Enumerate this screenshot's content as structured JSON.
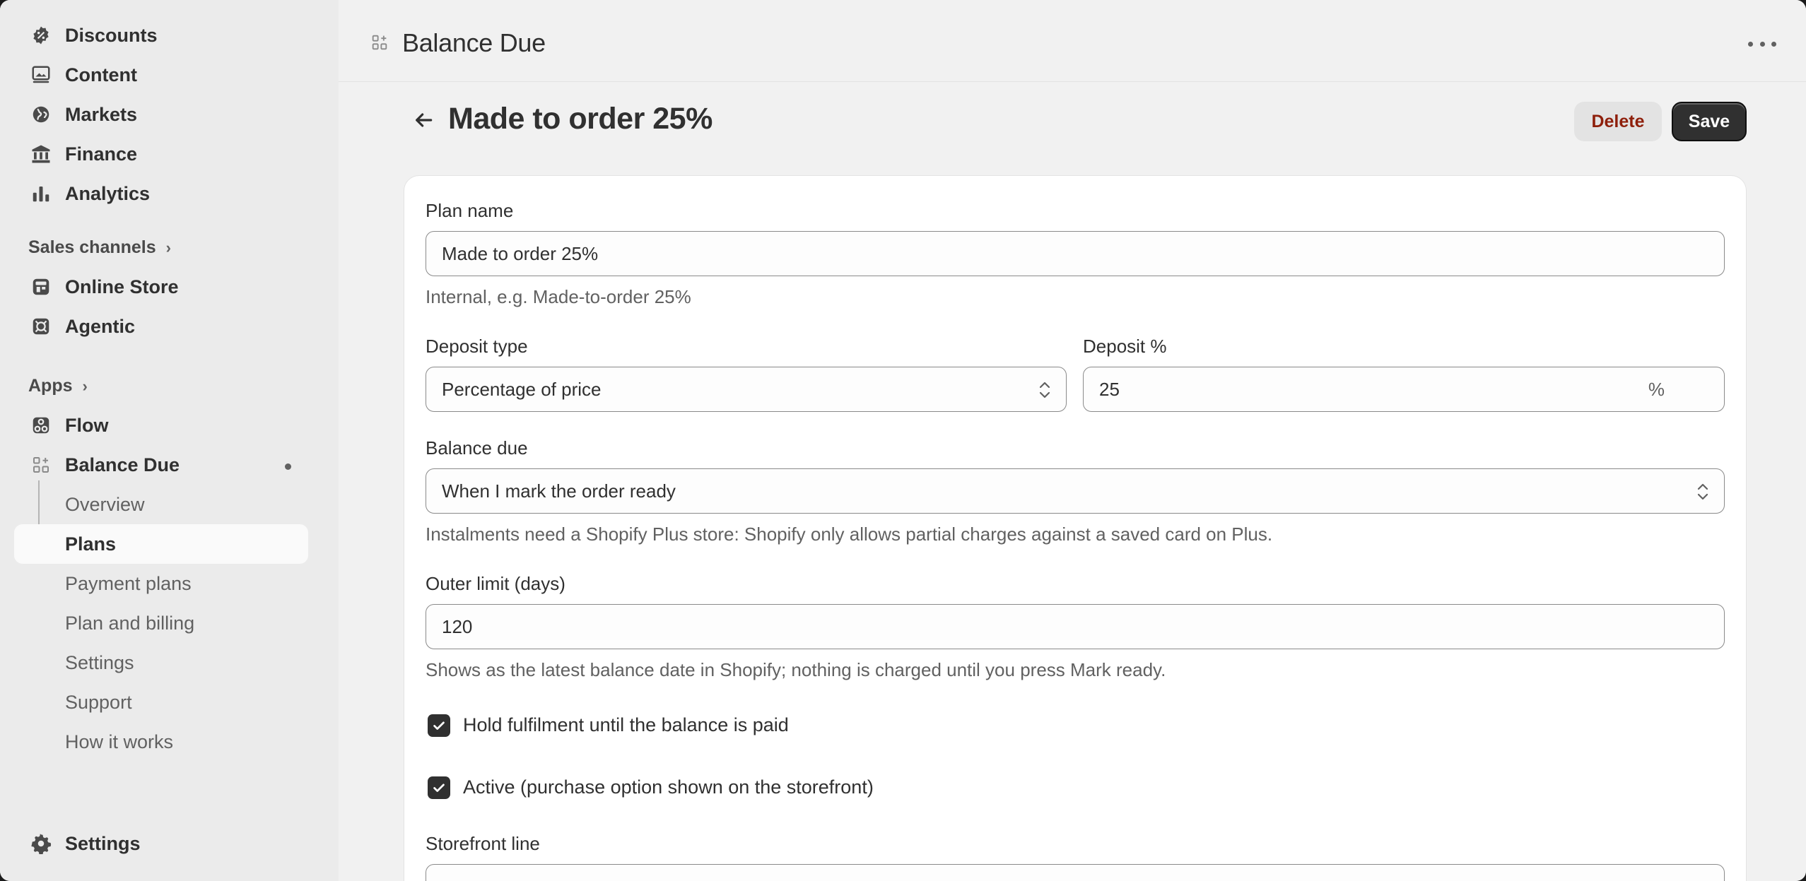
{
  "sidebar": {
    "items_top": [
      {
        "label": "Discounts",
        "icon": "discount-icon"
      },
      {
        "label": "Content",
        "icon": "content-icon"
      },
      {
        "label": "Markets",
        "icon": "globe-icon"
      },
      {
        "label": "Finance",
        "icon": "bank-icon"
      },
      {
        "label": "Analytics",
        "icon": "bar-chart-icon"
      }
    ],
    "sales_channels": {
      "heading": "Sales channels",
      "items": [
        {
          "label": "Online Store",
          "icon": "store-icon"
        },
        {
          "label": "Agentic",
          "icon": "agentic-icon"
        }
      ]
    },
    "apps": {
      "heading": "Apps",
      "items": [
        {
          "label": "Flow",
          "icon": "flow-icon"
        },
        {
          "label": "Balance Due",
          "icon": "app-grid-icon"
        }
      ],
      "subitems": [
        {
          "label": "Overview"
        },
        {
          "label": "Plans"
        },
        {
          "label": "Payment plans"
        },
        {
          "label": "Plan and billing"
        },
        {
          "label": "Settings"
        },
        {
          "label": "Support"
        },
        {
          "label": "How it works"
        }
      ]
    },
    "settings": {
      "label": "Settings",
      "icon": "gear-icon"
    }
  },
  "app_bar": {
    "title": "Balance Due"
  },
  "page": {
    "title": "Made to order 25%",
    "delete_label": "Delete",
    "save_label": "Save"
  },
  "form": {
    "plan_name": {
      "label": "Plan name",
      "value": "Made to order 25%",
      "help": "Internal, e.g. Made-to-order 25%"
    },
    "deposit_type": {
      "label": "Deposit type",
      "value": "Percentage of price"
    },
    "deposit_percent": {
      "label": "Deposit %",
      "value": "25",
      "suffix": "%"
    },
    "balance_due": {
      "label": "Balance due",
      "value": "When I mark the order ready",
      "help": "Instalments need a Shopify Plus store: Shopify only allows partial charges against a saved card on Plus."
    },
    "outer_limit": {
      "label": "Outer limit (days)",
      "value": "120",
      "help": "Shows as the latest balance date in Shopify; nothing is charged until you press Mark ready."
    },
    "hold_fulfilment": {
      "label": "Hold fulfilment until the balance is paid",
      "checked": true
    },
    "active": {
      "label": "Active (purchase option shown on the storefront)",
      "checked": true
    },
    "storefront_line": {
      "label": "Storefront line"
    }
  }
}
